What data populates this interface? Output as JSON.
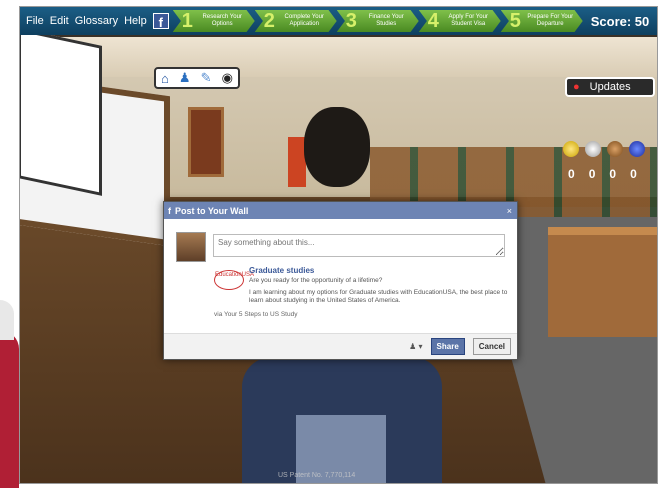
{
  "menu": {
    "file": "File",
    "edit": "Edit",
    "glossary": "Glossary",
    "help": "Help",
    "facebook": "f"
  },
  "steps": [
    {
      "num": "1",
      "label": "Research Your Options"
    },
    {
      "num": "2",
      "label": "Complete Your Application"
    },
    {
      "num": "3",
      "label": "Finance Your Studies"
    },
    {
      "num": "4",
      "label": "Apply For Your Student Visa"
    },
    {
      "num": "5",
      "label": "Prepare For Your Departure"
    }
  ],
  "score": "Score: 50",
  "updates": "Updates",
  "medal_counts": [
    "0",
    "0",
    "0",
    "0"
  ],
  "patent": "US Patent No. 7,770,114",
  "dialog": {
    "title": "Post to Your Wall",
    "close": "×",
    "placeholder": "Say something about this...",
    "logo_text": "EducationUSA",
    "post_title": "Graduate studies",
    "caption": "Are you ready for the opportunity of a lifetime?",
    "description": "I am learning about my options for Graduate studies with EducationUSA, the best place to learn about studying in the United States of America.",
    "via": "via Your 5 Steps to US Study",
    "privacy": "▾",
    "share": "Share",
    "cancel": "Cancel"
  },
  "colors": {
    "facebook_header": "#6d84b4",
    "step_green": "#6aaa36",
    "topbar": "#135479"
  },
  "icons": [
    "home-icon",
    "person-icon",
    "pencil-icon",
    "bag-icon",
    "globe-icon"
  ]
}
